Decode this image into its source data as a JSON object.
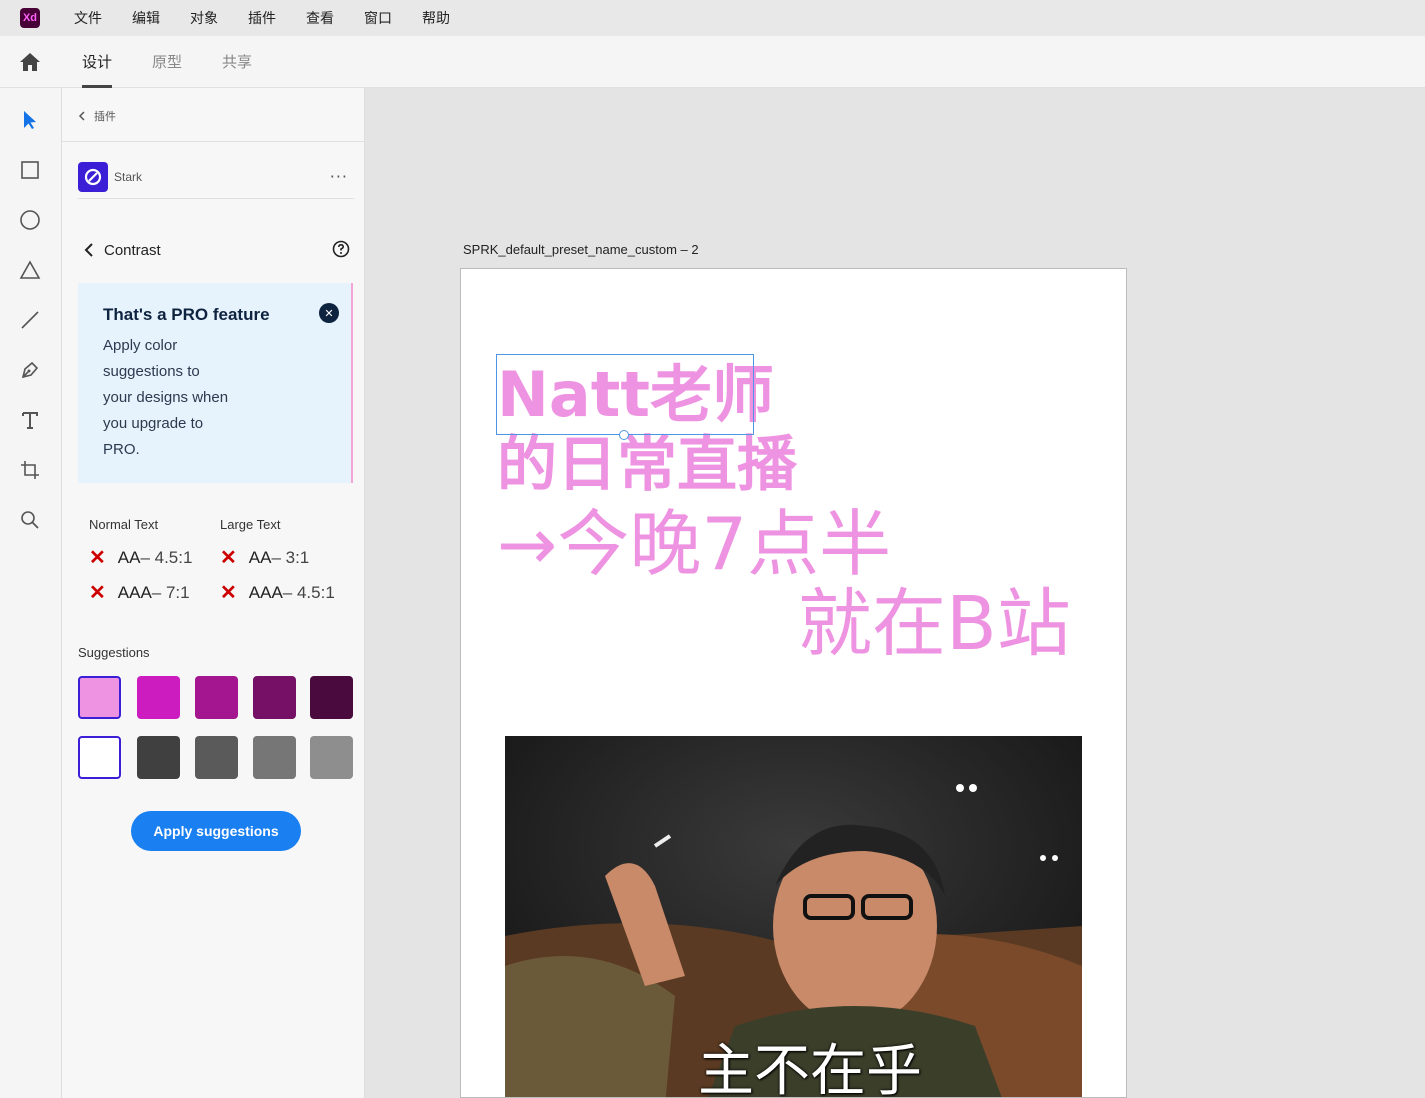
{
  "menubar": {
    "logo": "Xd",
    "items": [
      "文件",
      "编辑",
      "对象",
      "插件",
      "查看",
      "窗口",
      "帮助"
    ]
  },
  "modebar": {
    "tabs": [
      {
        "label": "设计",
        "active": true
      },
      {
        "label": "原型",
        "active": false
      },
      {
        "label": "共享",
        "active": false
      }
    ]
  },
  "toolbar": {
    "tools": [
      "select-icon",
      "rectangle-icon",
      "ellipse-icon",
      "triangle-icon",
      "line-icon",
      "pen-icon",
      "text-icon",
      "artboard-icon",
      "zoom-icon"
    ]
  },
  "panel": {
    "back_label": "插件",
    "plugin_name": "Stark",
    "more": "···",
    "contrast_title": "Contrast",
    "pro": {
      "title": "That's a PRO feature",
      "lines": [
        "Apply color",
        "suggestions to",
        "your designs when",
        "you upgrade to",
        "PRO."
      ]
    },
    "standards": {
      "normal_header": "Normal Text",
      "large_header": "Large Text",
      "normal": [
        {
          "level": "AA",
          "ratio": "– 4.5:1"
        },
        {
          "level": "AAA",
          "ratio": "– 7:1"
        }
      ],
      "large": [
        {
          "level": "AA",
          "ratio": "– 3:1"
        },
        {
          "level": "AAA",
          "ratio": "– 4.5:1"
        }
      ]
    },
    "suggestions_label": "Suggestions",
    "swatches_row1": [
      "#ee93e1",
      "#cc1cbf",
      "#a3168f",
      "#761066",
      "#4a0a3e"
    ],
    "swatches_row2": [
      "#ffffff",
      "#404040",
      "#5a5a5a",
      "#767676",
      "#8e8e8e"
    ],
    "apply_label": "Apply suggestions"
  },
  "canvas": {
    "artboard_label": "SPRK_default_preset_name_custom – 2",
    "line1": "Natt老师",
    "line2": "的日常直播",
    "line3": "→今晚7点半",
    "line4": "就在B站",
    "photo_caption": "主不在乎",
    "text_color": "#ee93e1"
  }
}
